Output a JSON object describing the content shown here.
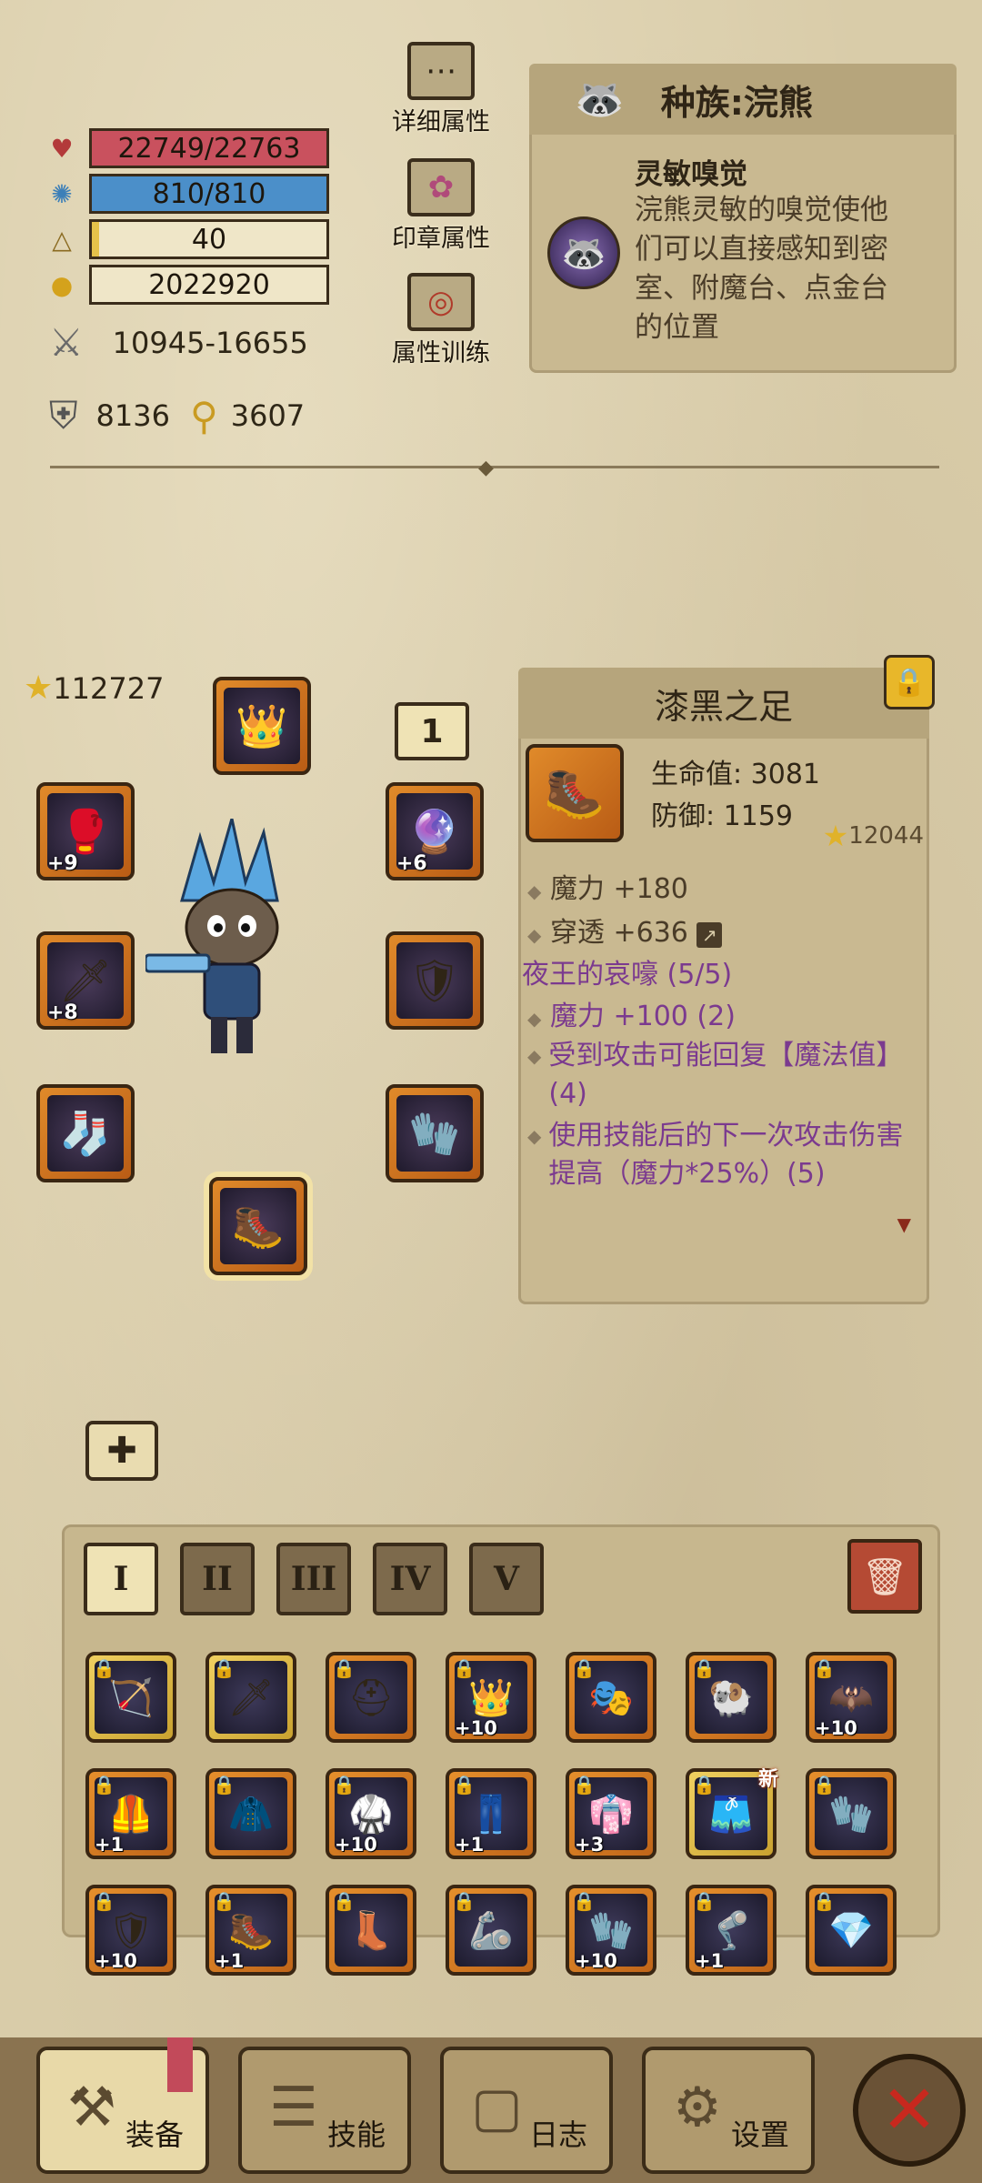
{
  "stats": {
    "hp": "22749/22763",
    "hp_fill": 0.999,
    "mana": "810/810",
    "mana_fill": 1.0,
    "level": "40",
    "level_fill": 0.03,
    "gold": "2022920",
    "attack": "10945-16655",
    "defense": "8136",
    "magic": "3607"
  },
  "side_buttons": {
    "detail": "详细属性",
    "seal": "印章属性",
    "training": "属性训练"
  },
  "race": {
    "title": "种族:浣熊",
    "skill_name": "灵敏嗅觉",
    "skill_desc": "浣熊灵敏的嗅觉使他们可以直接感知到密室、附魔台、点金台的位置"
  },
  "equip": {
    "power": "112727",
    "set_number": "1",
    "slots": [
      {
        "name": "weapon-left",
        "plus": "+9",
        "icon": "🥊"
      },
      {
        "name": "shield",
        "plus": "+8",
        "icon": "🗡"
      },
      {
        "name": "boots-left",
        "plus": "",
        "icon": "🧦"
      },
      {
        "name": "helmet",
        "plus": "",
        "icon": "👑"
      },
      {
        "name": "amulet",
        "plus": "+6",
        "icon": "🔮"
      },
      {
        "name": "armor",
        "plus": "",
        "icon": "🛡"
      },
      {
        "name": "gloves",
        "plus": "",
        "icon": "🧤"
      },
      {
        "name": "feet",
        "plus": "",
        "icon": "🥾"
      }
    ]
  },
  "item": {
    "name": "漆黑之足",
    "hp": "生命值: 3081",
    "defense": "防御: 1159",
    "score": "12044",
    "attr1": "魔力 +180",
    "attr2": "穿透 +636",
    "set_name": "夜王的哀嚎 (5/5)",
    "set1": "魔力 +100 (2)",
    "set2": "受到攻击可能回复【魔法值】(4)",
    "set3": "使用技能后的下一次攻击伤害提高（魔力*25%）(5)"
  },
  "tabs": [
    "I",
    "II",
    "III",
    "IV",
    "V"
  ],
  "inventory": [
    {
      "icon": "🏹",
      "plus": "",
      "gold": true,
      "new": ""
    },
    {
      "icon": "🗡",
      "plus": "",
      "gold": true,
      "new": ""
    },
    {
      "icon": "⛑",
      "plus": "",
      "gold": false,
      "new": ""
    },
    {
      "icon": "👑",
      "plus": "+10",
      "gold": false,
      "new": ""
    },
    {
      "icon": "🎭",
      "plus": "",
      "gold": false,
      "new": ""
    },
    {
      "icon": "🐏",
      "plus": "",
      "gold": false,
      "new": ""
    },
    {
      "icon": "🦇",
      "plus": "+10",
      "gold": false,
      "new": ""
    },
    {
      "icon": "🦺",
      "plus": "+1",
      "gold": false,
      "new": ""
    },
    {
      "icon": "🧥",
      "plus": "",
      "gold": false,
      "new": ""
    },
    {
      "icon": "🥋",
      "plus": "+10",
      "gold": false,
      "new": ""
    },
    {
      "icon": "👖",
      "plus": "+1",
      "gold": false,
      "new": ""
    },
    {
      "icon": "👘",
      "plus": "+3",
      "gold": false,
      "new": ""
    },
    {
      "icon": "🩳",
      "plus": "",
      "gold": true,
      "new": "新"
    },
    {
      "icon": "🧤",
      "plus": "",
      "gold": false,
      "new": ""
    },
    {
      "icon": "🛡",
      "plus": "+10",
      "gold": false,
      "new": ""
    },
    {
      "icon": "🥾",
      "plus": "+1",
      "gold": false,
      "new": ""
    },
    {
      "icon": "👢",
      "plus": "",
      "gold": false,
      "new": ""
    },
    {
      "icon": "🦾",
      "plus": "",
      "gold": false,
      "new": ""
    },
    {
      "icon": "🧤",
      "plus": "+10",
      "gold": false,
      "new": ""
    },
    {
      "icon": "🦿",
      "plus": "+1",
      "gold": false,
      "new": ""
    },
    {
      "icon": "💎",
      "plus": "",
      "gold": false,
      "new": ""
    }
  ],
  "nav": {
    "equip": "装备",
    "skills": "技能",
    "log": "日志",
    "settings": "设置"
  },
  "colors": {
    "hp_bar": "#c9515e",
    "mana_bar": "#4b8fc9",
    "level_bar": "#e5c24a",
    "purple_text": "#7b3a8f",
    "close_red": "#c8281e"
  }
}
